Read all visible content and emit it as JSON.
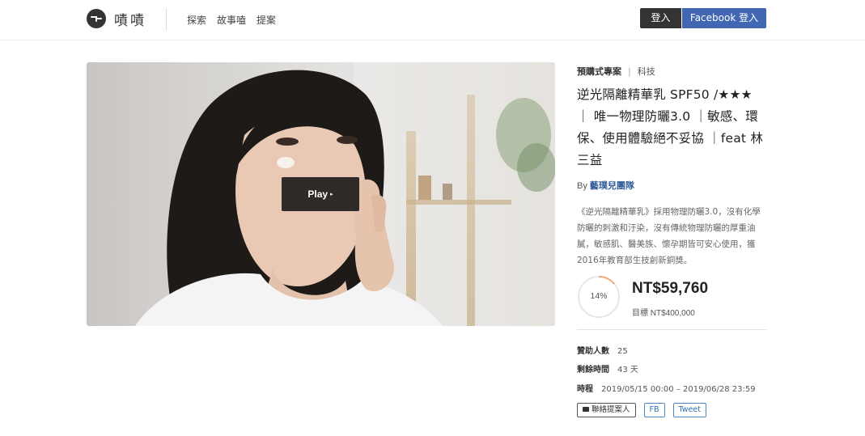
{
  "header": {
    "logo_text": "嘖嘖",
    "nav": [
      "探索",
      "故事嗑",
      "提案"
    ],
    "login_label": "登入",
    "facebook_login_label": "Facebook 登入"
  },
  "video": {
    "play_label": "Play",
    "play_icon": "▸"
  },
  "project": {
    "type": "預購式專案",
    "separator": "|",
    "category": "科技",
    "title": "逆光隔離精華乳 SPF50 /★★★ ｜ 唯一物理防曬3.0 ｜敏感、環保、使用體驗絕不妥協 ｜feat 林三益",
    "by_label": "By",
    "team": "藝璞兒團隊",
    "description": "《逆光隔離精華乳》採用物理防曬3.0，沒有化學防曬的刺激和汙染，沒有傳統物理防曬的厚重油膩，敏感肌、醫美族、懷孕期皆可安心使用，獲2016年教育部生技創新銅獎。",
    "progress_percent": 14,
    "progress_label": "14%",
    "amount": "NT$59,760",
    "goal": "目標 NT$400,000"
  },
  "stats": {
    "backers_label": "贊助人數",
    "backers_value": "25",
    "remaining_label": "剩餘時間",
    "remaining_value": "43 天",
    "period_label": "時程",
    "period_value": "2019/05/15 00:00 – 2019/06/28 23:59"
  },
  "share": {
    "contact_label": "聯絡提案人",
    "fb_label": "FB",
    "tweet_label": "Tweet"
  },
  "colors": {
    "facebook": "#4267b2",
    "progress_accent": "#f0a878",
    "link": "#2f5c9a"
  }
}
